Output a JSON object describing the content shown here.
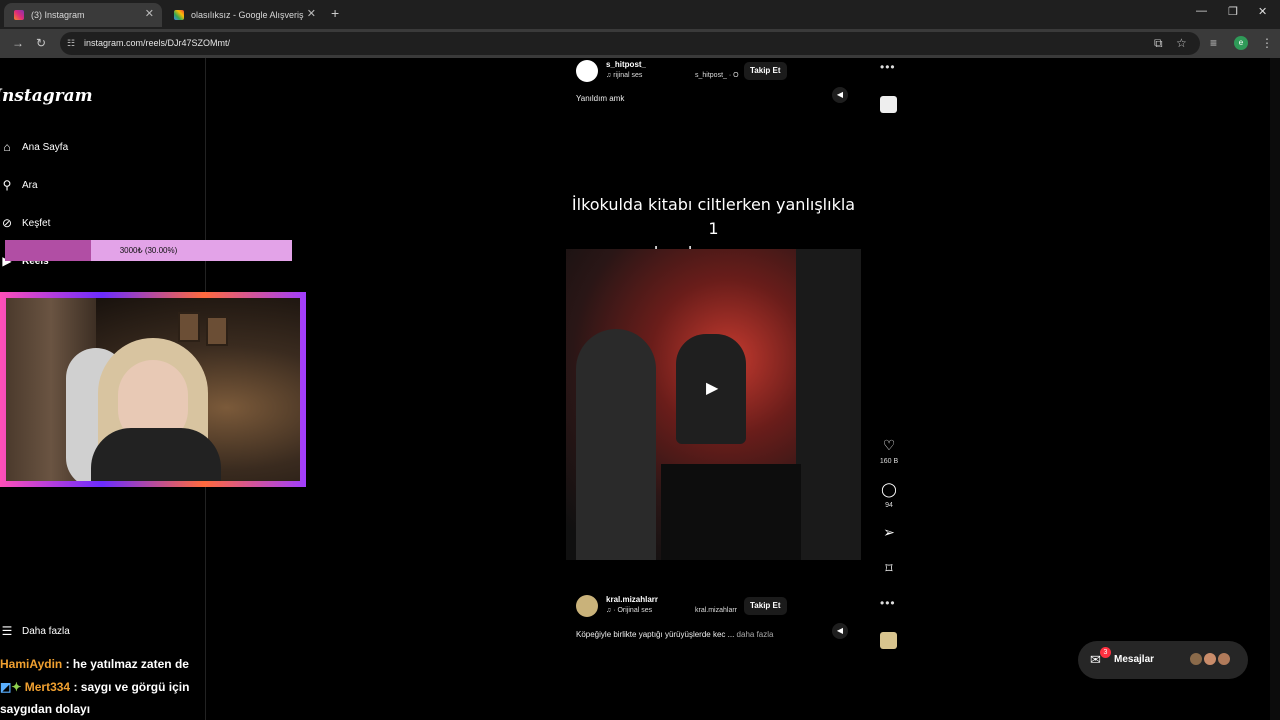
{
  "browser": {
    "tabs": [
      {
        "title": "(3) Instagram",
        "active": true
      },
      {
        "title": "olasılıksız - Google Alışveriş",
        "active": false
      }
    ],
    "url": "instagram.com/reels/DJr47SZOMmt/",
    "profile_initial": "e"
  },
  "sidebar": {
    "logo": "Instagram",
    "items": [
      {
        "label": "Ana Sayfa",
        "icon": "home-icon"
      },
      {
        "label": "Ara",
        "icon": "search-icon"
      },
      {
        "label": "Keşfet",
        "icon": "compass-icon"
      },
      {
        "label": "Reels",
        "icon": "reels-icon"
      },
      {
        "label": "Daha fazla",
        "icon": "menu-icon"
      }
    ]
  },
  "overlay": {
    "goal_text": "3000₺ (30.00%)",
    "goal_progress": 0.3
  },
  "reel1": {
    "username": "s_hitpost_",
    "audio": "rijinal ses",
    "audio_user": "s_hitpost_ · O",
    "follow_label": "Takip Et",
    "caption": "Yanıldım amk"
  },
  "video": {
    "title_line1": "İlkokulda kitabı ciltlerken yanlışlıkla 1",
    "title_line2": "cm kaydırınca annem:"
  },
  "actions": {
    "likes": "160 B",
    "comments": "94"
  },
  "reel2": {
    "username": "kral.mizahlarr",
    "audio": "· Orijinal ses",
    "audio_user": "kral.mizahlarr",
    "follow_label": "Takip Et",
    "caption": "Köpeğiyle birlikte yaptığı yürüyüşlerde kec ...",
    "more": "daha fazla"
  },
  "messages": {
    "label": "Mesajlar",
    "badge": "3"
  },
  "chat": [
    {
      "user": "HamiAydin",
      "text": ": he yatılmaz zaten de"
    },
    {
      "user": "Mert334",
      "text": ": saygı ve görgü için"
    },
    {
      "user": "",
      "text": "saygıdan dolayı"
    }
  ],
  "colors": {
    "goal_fill": "#b14ea4",
    "goal_bg": "#e3a3e8",
    "badge": "#ff3040"
  }
}
